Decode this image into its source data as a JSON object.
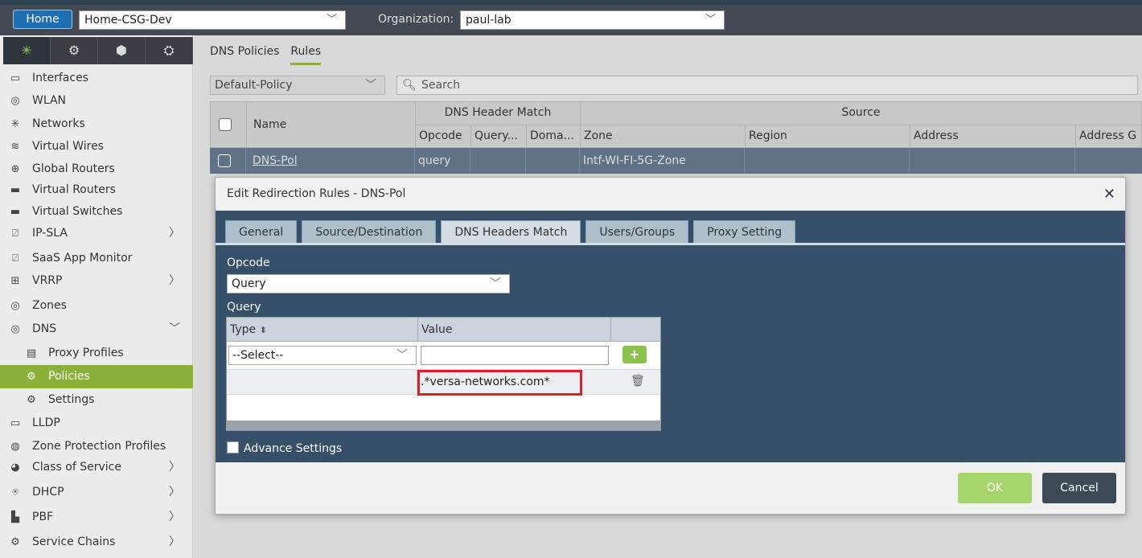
{
  "header": {
    "home_label": "Home",
    "appliance": "Home-CSG-Dev",
    "org_label": "Organization:",
    "org_value": "paul-lab"
  },
  "sidebar": {
    "icon_tabs": [
      "network-icon",
      "gear-icon",
      "cube-icon",
      "shield-gear-icon"
    ],
    "items": [
      {
        "label": "Interfaces",
        "icon": "interfaces-icon"
      },
      {
        "label": "WLAN",
        "icon": "wifi-icon"
      },
      {
        "label": "Networks",
        "icon": "network-icon"
      },
      {
        "label": "Virtual Wires",
        "icon": "wire-icon"
      },
      {
        "label": "Global Routers",
        "icon": "globe-router-icon"
      },
      {
        "label": "Virtual Routers",
        "icon": "router-icon"
      },
      {
        "label": "Virtual Switches",
        "icon": "switch-icon"
      },
      {
        "label": "IP-SLA",
        "icon": "pulse-icon"
      },
      {
        "label": "SaaS App Monitor",
        "icon": "pulse-icon"
      },
      {
        "label": "VRRP",
        "icon": "vrrp-icon"
      },
      {
        "label": "Zones",
        "icon": "wifi-icon"
      },
      {
        "label": "DNS",
        "icon": "wifi-icon"
      },
      {
        "label": "Proxy Profiles",
        "icon": "proxy-icon"
      },
      {
        "label": "Policies",
        "icon": "gears-icon"
      },
      {
        "label": "Settings",
        "icon": "gears-icon"
      },
      {
        "label": "LLDP",
        "icon": "monitor-icon"
      },
      {
        "label": "Zone Protection Profiles",
        "icon": "fingerprint-icon"
      },
      {
        "label": "Class of Service",
        "icon": "cos-icon"
      },
      {
        "label": "DHCP",
        "icon": "dhcp-icon"
      },
      {
        "label": "PBF",
        "icon": "pbf-icon"
      },
      {
        "label": "Service Chains",
        "icon": "gear-icon"
      }
    ]
  },
  "main": {
    "tabs": [
      "DNS Policies",
      "Rules"
    ],
    "policy_select": "Default-Policy",
    "search_placeholder": "Search",
    "grid": {
      "col_name": "Name",
      "group_dns": "DNS Header Match",
      "group_source": "Source",
      "col_opcode": "Opcode",
      "col_query": "Query...",
      "col_domain": "Doma...",
      "col_zone": "Zone",
      "col_region": "Region",
      "col_address": "Address",
      "col_address_group": "Address G",
      "row": {
        "name": "DNS-Pol",
        "opcode": "query",
        "zone": "Intf-WI-FI-5G-Zone"
      }
    }
  },
  "modal": {
    "title": "Edit Redirection Rules - DNS-Pol",
    "tabs": [
      "General",
      "Source/Destination",
      "DNS Headers Match",
      "Users/Groups",
      "Proxy Setting"
    ],
    "opcode_label": "Opcode",
    "opcode_value": "Query",
    "query_label": "Query",
    "col_type": "Type",
    "col_value": "Value",
    "type_placeholder": "--Select--",
    "query_row_value": ".*versa-networks.com*",
    "advance_settings": "Advance Settings",
    "ok": "OK",
    "cancel": "Cancel"
  }
}
